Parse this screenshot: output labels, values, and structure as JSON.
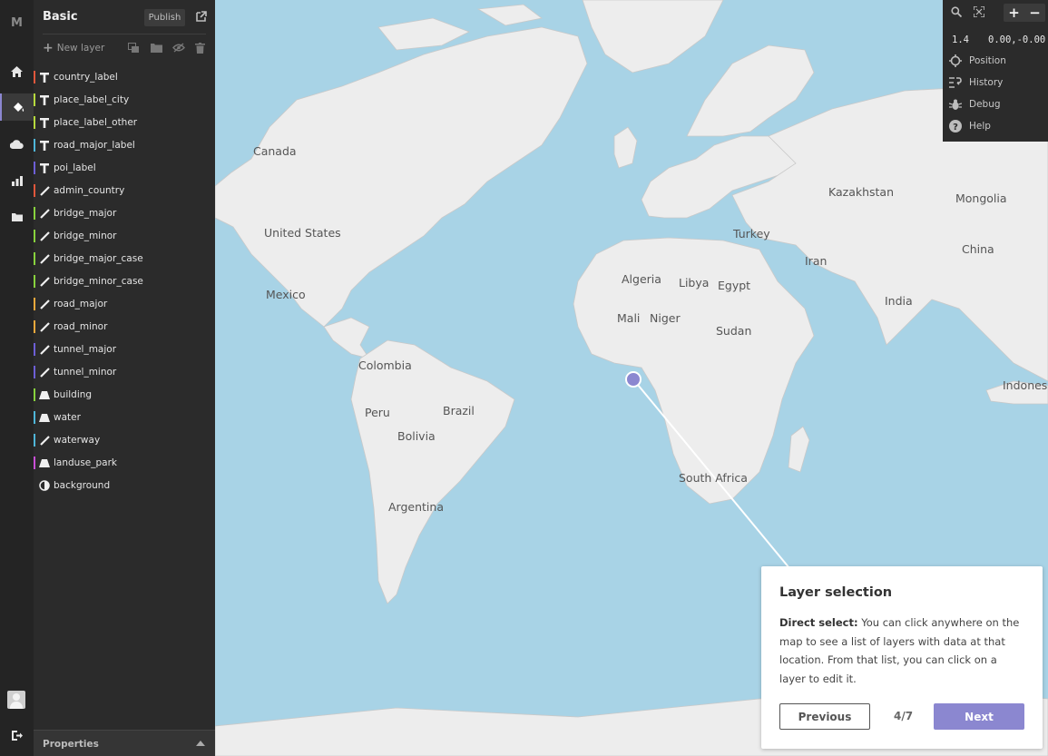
{
  "app": {
    "logo": "M"
  },
  "rail": {
    "items": [
      {
        "icon": "home-icon"
      },
      {
        "icon": "paint-bucket-icon",
        "active": true
      },
      {
        "icon": "cloud-icon"
      },
      {
        "icon": "bar-chart-icon"
      },
      {
        "icon": "folder-icon"
      }
    ],
    "bottom": [
      {
        "icon": "avatar"
      },
      {
        "icon": "logout-icon"
      }
    ]
  },
  "sidebar": {
    "title": "Basic",
    "publish_label": "Publish",
    "new_layer_label": "New layer",
    "layers": [
      {
        "name": "country_label",
        "type": "symbol",
        "color": "#e0573b"
      },
      {
        "name": "place_label_city",
        "type": "symbol",
        "color": "#b6d93d"
      },
      {
        "name": "place_label_other",
        "type": "symbol",
        "color": "#b6d93d"
      },
      {
        "name": "road_major_label",
        "type": "symbol",
        "color": "#4fb6d8"
      },
      {
        "name": "poi_label",
        "type": "symbol",
        "color": "#6d5fd6"
      },
      {
        "name": "admin_country",
        "type": "line",
        "color": "#e0573b"
      },
      {
        "name": "bridge_major",
        "type": "line",
        "color": "#88d23d"
      },
      {
        "name": "bridge_minor",
        "type": "line",
        "color": "#88d23d"
      },
      {
        "name": "bridge_major_case",
        "type": "line",
        "color": "#88d23d"
      },
      {
        "name": "bridge_minor_case",
        "type": "line",
        "color": "#88d23d"
      },
      {
        "name": "road_major",
        "type": "line",
        "color": "#f0a93c"
      },
      {
        "name": "road_minor",
        "type": "line",
        "color": "#f0a93c"
      },
      {
        "name": "tunnel_major",
        "type": "line",
        "color": "#6d5fd6"
      },
      {
        "name": "tunnel_minor",
        "type": "line",
        "color": "#6d5fd6"
      },
      {
        "name": "building",
        "type": "fill",
        "color": "#88d23d"
      },
      {
        "name": "water",
        "type": "fill",
        "color": "#4fb6d8"
      },
      {
        "name": "waterway",
        "type": "line",
        "color": "#4fb6d8"
      },
      {
        "name": "landuse_park",
        "type": "fill",
        "color": "#c94fd6"
      },
      {
        "name": "background",
        "type": "background",
        "color": ""
      }
    ],
    "properties_label": "Properties"
  },
  "map_labels": [
    {
      "text": "Canada"
    },
    {
      "text": "United States"
    },
    {
      "text": "Mexico"
    },
    {
      "text": "Colombia"
    },
    {
      "text": "Peru"
    },
    {
      "text": "Brazil"
    },
    {
      "text": "Bolivia"
    },
    {
      "text": "Argentina"
    },
    {
      "text": "Algeria"
    },
    {
      "text": "Libya"
    },
    {
      "text": "Egypt"
    },
    {
      "text": "Mali"
    },
    {
      "text": "Niger"
    },
    {
      "text": "Sudan"
    },
    {
      "text": "South Africa"
    },
    {
      "text": "Turkey"
    },
    {
      "text": "Iran"
    },
    {
      "text": "India"
    },
    {
      "text": "Kazakhstan"
    },
    {
      "text": "Mongolia"
    },
    {
      "text": "China"
    },
    {
      "text": "Indones"
    }
  ],
  "panel": {
    "zoom": "1.4",
    "coords": "0.00,-0.00",
    "zoom_in": "+",
    "zoom_out": "−",
    "items": [
      {
        "label": "Position",
        "icon": "crosshair-icon"
      },
      {
        "label": "History",
        "icon": "history-icon"
      },
      {
        "label": "Debug",
        "icon": "bug-icon"
      },
      {
        "label": "Help",
        "icon": "help-icon"
      }
    ]
  },
  "tour": {
    "title": "Layer selection",
    "body_bold": "Direct select:",
    "body": " You can click anywhere on the map to see a list of layers with data at that location. From that list, you can click on a layer to edit it.",
    "prev_label": "Previous",
    "step": "4/7",
    "next_label": "Next",
    "accent": "#8b87d0"
  }
}
